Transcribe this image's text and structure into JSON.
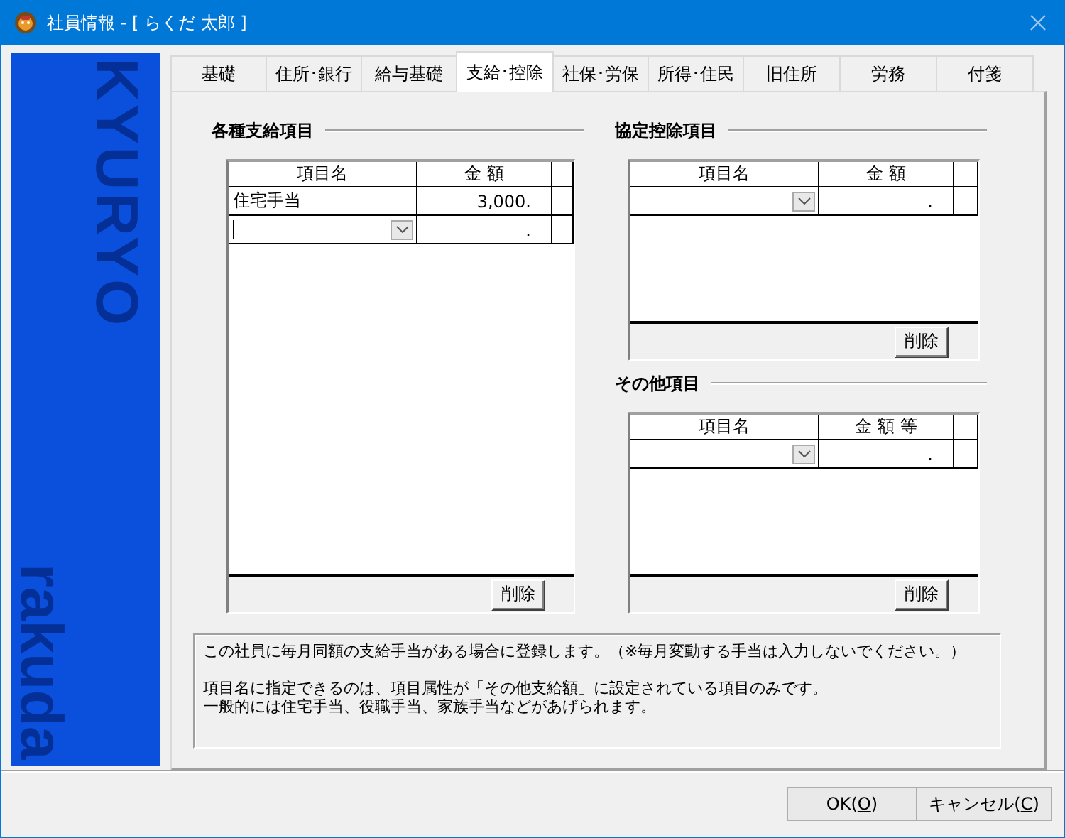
{
  "window": {
    "title": "社員情報 - [ らくだ 太郎 ]"
  },
  "sidebar": {
    "logo_texts": [
      "KYURYO",
      "rakuda"
    ]
  },
  "tabs": [
    {
      "label": "基礎",
      "selected": false
    },
    {
      "label": "住所･銀行",
      "selected": false
    },
    {
      "label": "給与基礎",
      "selected": false
    },
    {
      "label": "支給･控除",
      "selected": true
    },
    {
      "label": "社保･労保",
      "selected": false
    },
    {
      "label": "所得･住民",
      "selected": false
    },
    {
      "label": "旧住所",
      "selected": false
    },
    {
      "label": "労務",
      "selected": false
    },
    {
      "label": "付箋",
      "selected": false
    }
  ],
  "sections": [
    {
      "title": "各種支給項目",
      "columns": [
        "項目名",
        "金 額"
      ],
      "rows": [
        {
          "name": "住宅手当",
          "amount": "3,000.",
          "dropdown": false,
          "focused": false
        },
        {
          "amount": ".",
          "dropdown": true,
          "focused": true
        }
      ],
      "delete_button": "削除"
    },
    {
      "title": "協定控除項目",
      "columns": [
        "項目名",
        "金 額"
      ],
      "rows": [
        {
          "amount": ".",
          "dropdown": true,
          "focused": false
        }
      ],
      "delete_button": "削除"
    },
    {
      "title": "その他項目",
      "columns": [
        "項目名",
        "金 額 等"
      ],
      "rows": [
        {
          "amount": ".",
          "dropdown": true,
          "focused": false
        }
      ],
      "delete_button": "削除"
    }
  ],
  "info": {
    "paragraphs": [
      [
        "この社員に毎月同額の支給手当がある場合に登録します。（※毎月変動する手当は入力しないでください。）"
      ],
      [
        "項目名に指定できるのは、項目属性が「その他支給額」に設定されている項目のみです。",
        "一般的には住宅手当、役職手当、家族手当などがあげられます。"
      ]
    ]
  },
  "buttons": [
    {
      "before": "OK(",
      "key": "O",
      "after": ")"
    },
    {
      "before": "キャンセル(",
      "key": "C",
      "after": ")"
    }
  ]
}
